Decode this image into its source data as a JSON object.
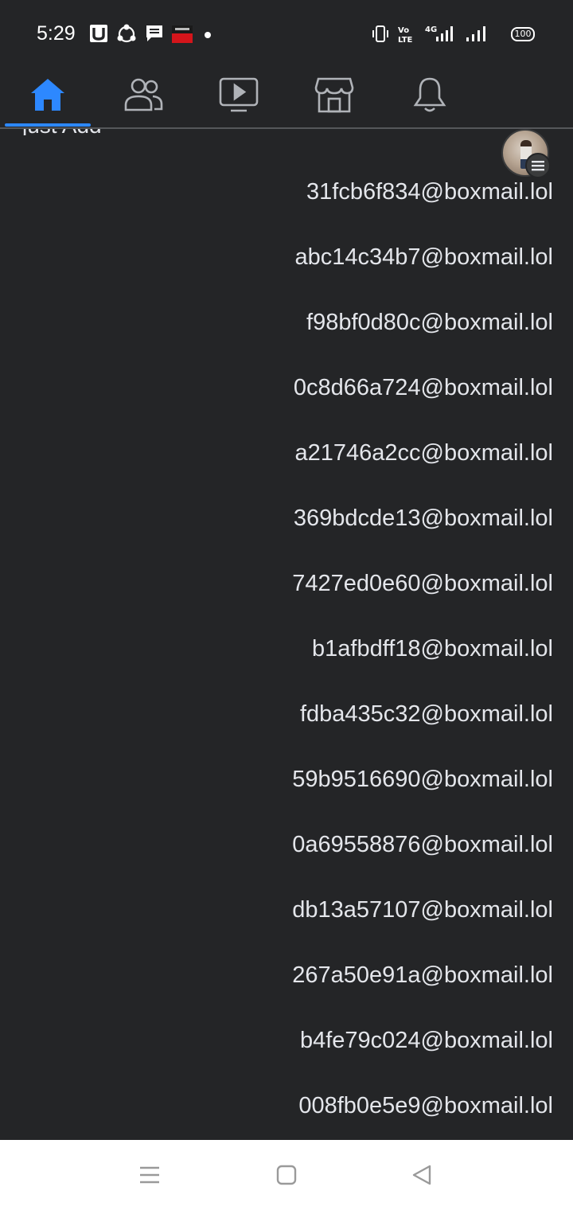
{
  "status_bar": {
    "time": "5:29",
    "left_icons": [
      "u-app-icon",
      "share-icon",
      "message-icon",
      "app-thumbnail-icon",
      "dot-icon"
    ],
    "right_icons": [
      "vibrate-icon",
      "volte-icon",
      "signal-4g-icon",
      "signal-icon"
    ],
    "battery": "100"
  },
  "nav": {
    "items": [
      {
        "name": "home",
        "active": true
      },
      {
        "name": "friends",
        "active": false
      },
      {
        "name": "watch",
        "active": false
      },
      {
        "name": "marketplace",
        "active": false
      },
      {
        "name": "notifications",
        "active": false
      },
      {
        "name": "profile-menu",
        "active": false
      }
    ],
    "accent_color": "#2d88ff"
  },
  "cut_off_text": "just Add",
  "emails": [
    "31fcb6f834@boxmail.lol",
    "abc14c34b7@boxmail.lol",
    "f98bf0d80c@boxmail.lol",
    "0c8d66a724@boxmail.lol",
    "a21746a2cc@boxmail.lol",
    "369bdcde13@boxmail.lol",
    "7427ed0e60@boxmail.lol",
    "b1afbdff18@boxmail.lol",
    "fdba435c32@boxmail.lol",
    "59b9516690@boxmail.lol",
    "0a69558876@boxmail.lol",
    "db13a57107@boxmail.lol",
    "267a50e91a@boxmail.lol",
    "b4fe79c024@boxmail.lol",
    "008fb0e5e9@boxmail.lol"
  ],
  "system_nav": {
    "buttons": [
      "menu-icon",
      "home-square-icon",
      "back-triangle-icon"
    ]
  }
}
